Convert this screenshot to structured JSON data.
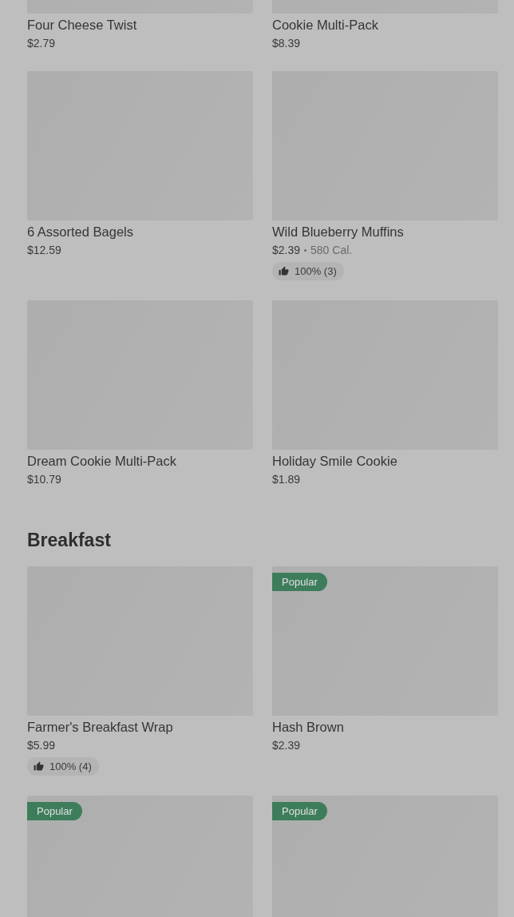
{
  "sections": [
    {
      "items": [
        {
          "name": "Four Cheese Twist",
          "price": "$2.79"
        },
        {
          "name": "Cookie Multi-Pack",
          "price": "$8.39"
        },
        {
          "name": "6 Assorted Bagels",
          "price": "$12.59"
        },
        {
          "name": "Wild Blueberry Muffins",
          "price": "$2.39",
          "calories": "580 Cal.",
          "rating": "100% (3)"
        },
        {
          "name": "Dream Cookie Multi-Pack",
          "price": "$10.79"
        },
        {
          "name": "Holiday Smile Cookie",
          "price": "$1.89"
        }
      ]
    },
    {
      "title": "Breakfast",
      "items": [
        {
          "name": "Farmer's Breakfast Wrap",
          "price": "$5.99",
          "rating": "100% (4)"
        },
        {
          "name": "Hash Brown",
          "price": "$2.39",
          "badge": "Popular"
        },
        {
          "badge": "Popular"
        },
        {
          "badge": "Popular"
        }
      ]
    }
  ]
}
